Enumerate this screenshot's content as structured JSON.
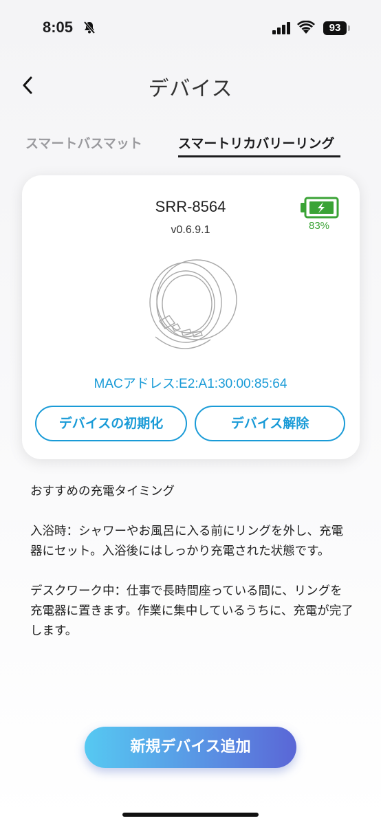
{
  "status_bar": {
    "time": "8:05",
    "battery": "93",
    "icons": [
      "bell-slash-icon",
      "signal-icon",
      "wifi-icon",
      "battery-icon"
    ]
  },
  "header": {
    "title": "デバイス",
    "back_icon": "chevron-left-icon"
  },
  "tabs": [
    {
      "label": "スマートバスマット",
      "active": false
    },
    {
      "label": "スマートリカバリーリング",
      "active": true
    }
  ],
  "device": {
    "name": "SRR-8564",
    "version": "v0.6.9.1",
    "battery_percent": "83%",
    "battery_icon": "battery-charging-icon",
    "image_icon": "ring-icon",
    "mac": "MACアドレス:E2:A1:30:00:85:64",
    "reset_label": "デバイスの初期化",
    "unpair_label": "デバイス解除"
  },
  "tips": {
    "heading": "おすすめの充電タイミング",
    "paragraph1": "入浴時：シャワーやお風呂に入る前にリングを外し、充電器にセット。入浴後にはしっかり充電された状態です。",
    "paragraph2": "デスクワーク中：仕事で長時間座っている間に、リングを充電器に置きます。作業に集中しているうちに、充電が完了します。"
  },
  "add_button_label": "新規デバイス追加",
  "colors": {
    "accent": "#1a9bd7",
    "battery_green": "#3aa335",
    "gradient_start": "#56c9f2",
    "gradient_end": "#5a66d6"
  }
}
